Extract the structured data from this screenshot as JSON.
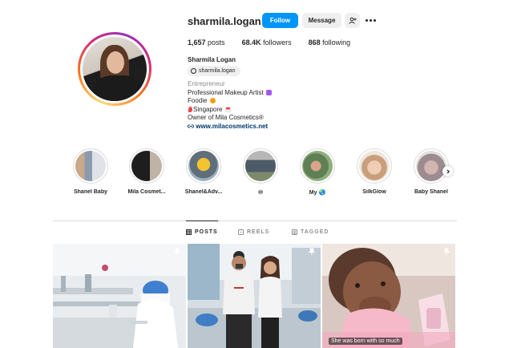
{
  "profile": {
    "username": "sharmila.logan",
    "follow_label": "Follow",
    "message_label": "Message",
    "suggest_label": "+",
    "stats": {
      "posts": "1,657",
      "posts_label": "posts",
      "followers": "68.4K",
      "followers_label": "followers",
      "following": "868",
      "following_label": "following"
    },
    "full_name": "Sharmila Logan",
    "threads_handle": "sharmila.logan",
    "bio": {
      "category": "Entrepreneur",
      "line1": "Professional Makeup Artist",
      "line2": "Foodie",
      "line3": "Singapore",
      "line4": "Owner of Mila Cosmetics®",
      "link": "www.milacosmetics.net"
    }
  },
  "highlights": [
    {
      "label": "Shanel Baby",
      "icon": "highlight-thumb"
    },
    {
      "label": "Mila Cosmet...",
      "icon": "highlight-thumb"
    },
    {
      "label": "Shanel&Adv...",
      "icon": "highlight-thumb"
    },
    {
      "label": "♾",
      "icon": "highlight-thumb"
    },
    {
      "label": "My 🌏",
      "icon": "highlight-thumb"
    },
    {
      "label": "SilkGlow",
      "icon": "highlight-thumb"
    },
    {
      "label": "Baby Shanel",
      "icon": "highlight-thumb"
    }
  ],
  "tabs": [
    {
      "label": "POSTS",
      "active": true,
      "icon": "grid-icon"
    },
    {
      "label": "REELS",
      "active": false,
      "icon": "reels-icon"
    },
    {
      "label": "TAGGED",
      "active": false,
      "icon": "tagged-icon"
    }
  ],
  "posts": [
    {
      "caption": "",
      "pinned": true
    },
    {
      "caption": "",
      "pinned": true
    },
    {
      "caption": "She was born with so much",
      "pinned": true
    }
  ],
  "colors": {
    "accent": "#0095f6",
    "link": "#00376b",
    "secondary_text": "#8e8e8e"
  }
}
